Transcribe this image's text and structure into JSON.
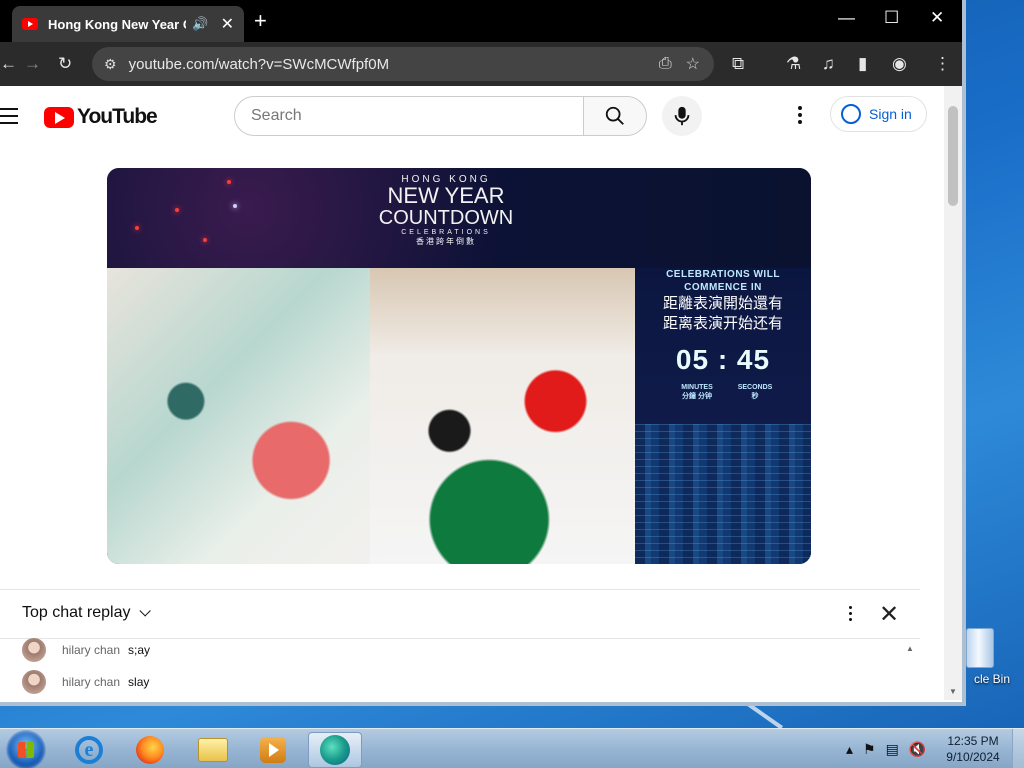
{
  "browser": {
    "tab_title": "Hong Kong New Year Countdown",
    "url": "youtube.com/watch?v=SWcMCWfpf0M",
    "new_tab_label": "+",
    "close_tab_label": "✕",
    "minimize": "—",
    "maximize": "☐",
    "close": "✕"
  },
  "youtube": {
    "logo_text": "YouTube",
    "search_placeholder": "Search",
    "sign_in_label": "Sign in"
  },
  "video": {
    "overlay_hk": "HONG KONG",
    "overlay_new_year": "NEW YEAR",
    "overlay_countdown": "COUNTDOWN",
    "overlay_celebrations": "CELEBRATIONS",
    "overlay_zh_small": "香港跨年倒數",
    "celebrations_en": "CELEBRATIONS WILL COMMENCE IN",
    "celebrations_zh_trad": "距離表演開始還有",
    "celebrations_zh_simp": "距离表演开始还有",
    "countdown": "05 : 45",
    "minutes_label": "MINUTES",
    "seconds_label": "SECONDS",
    "minutes_zh": "分鐘 分钟",
    "seconds_zh": "秒"
  },
  "chat": {
    "header": "Top chat replay",
    "messages": [
      {
        "author": "hilary chan",
        "text": "s;ay"
      },
      {
        "author": "hilary chan",
        "text": "slay"
      }
    ]
  },
  "desktop": {
    "recycle_bin_label": "cle Bin"
  },
  "taskbar": {
    "time": "12:35 PM",
    "date": "9/10/2024"
  }
}
